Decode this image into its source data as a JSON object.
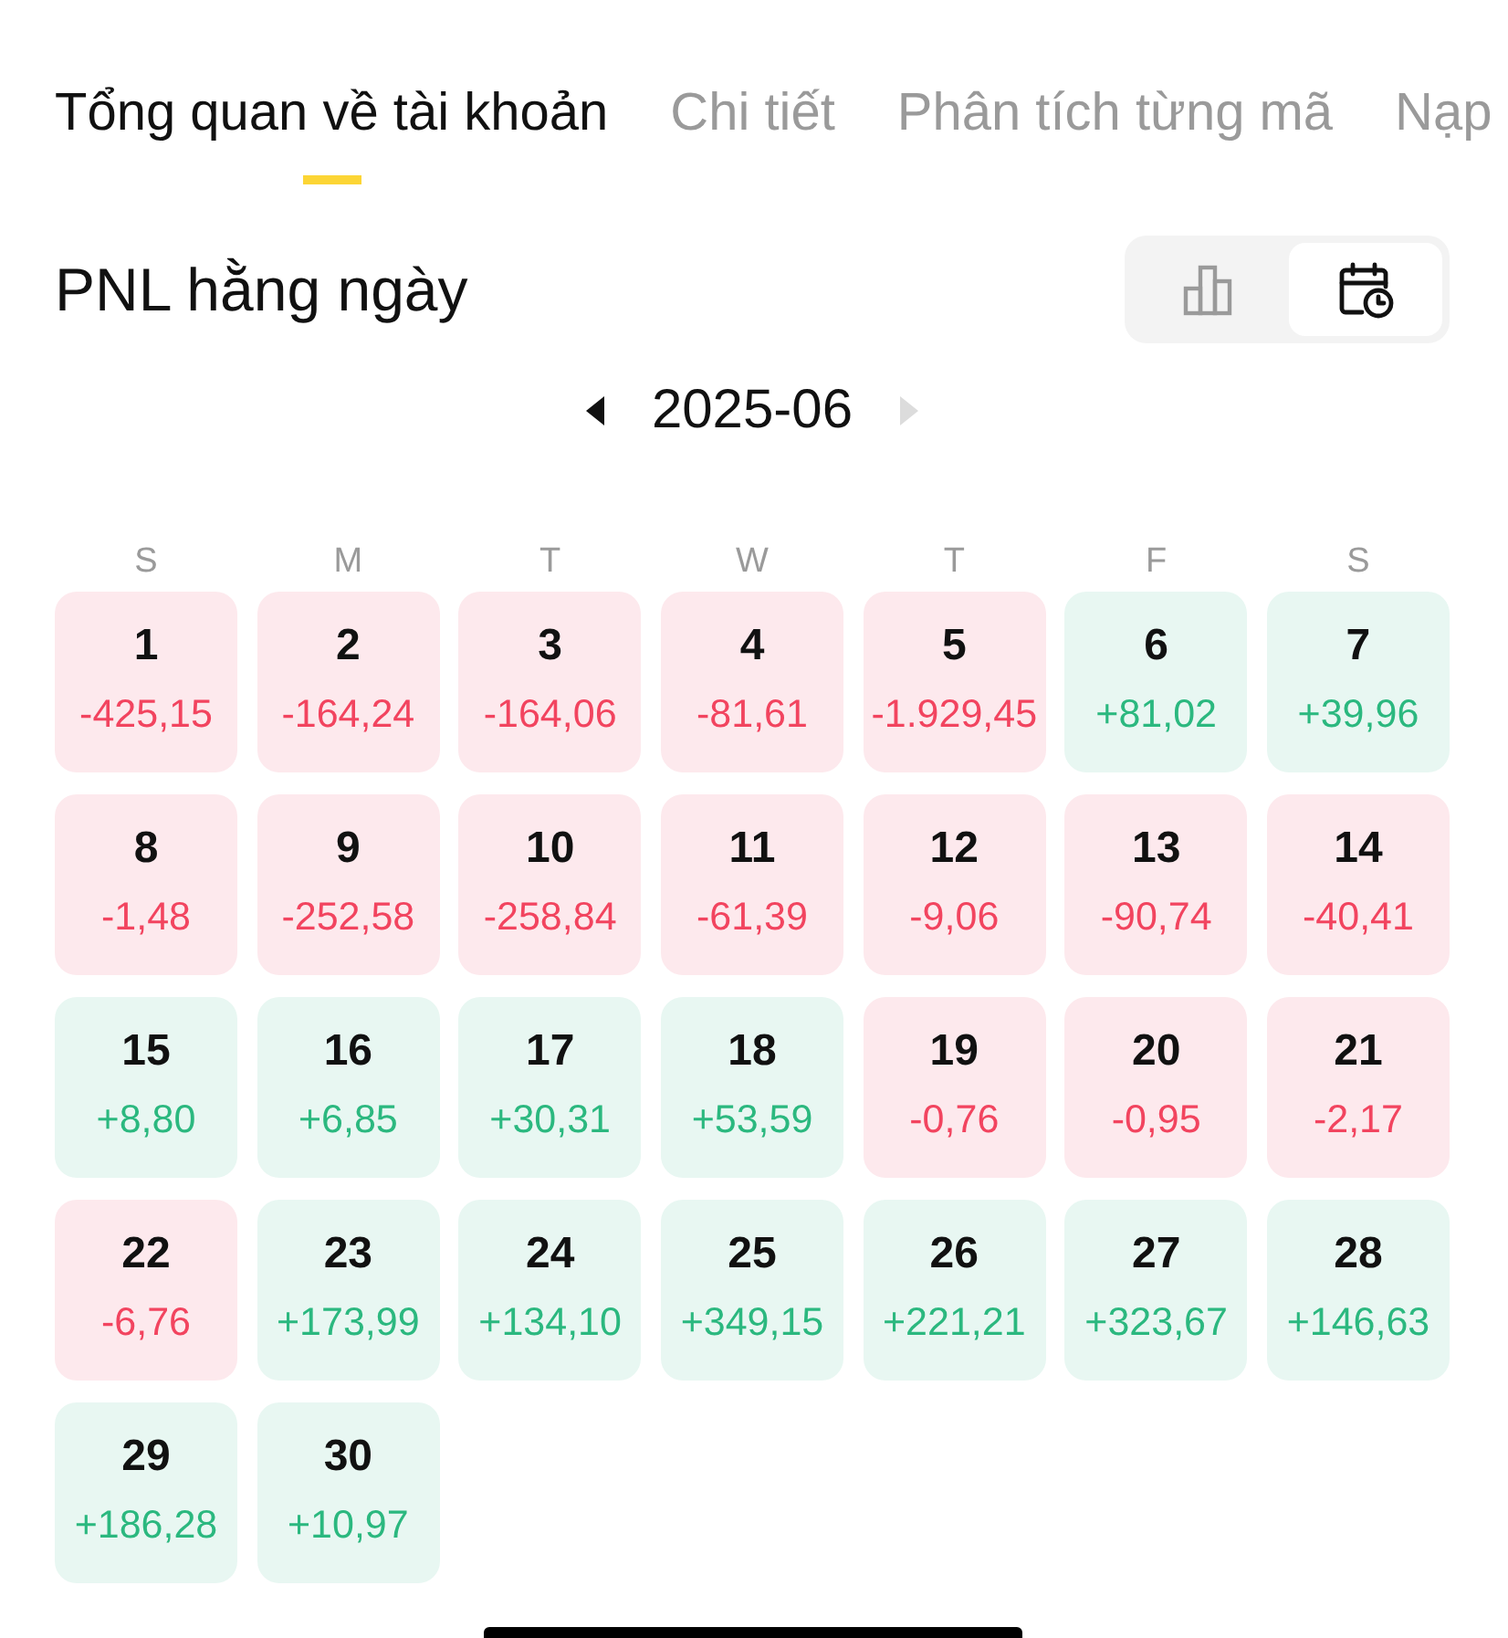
{
  "tabs": [
    {
      "label": "Tổng quan về tài khoản",
      "selected": true
    },
    {
      "label": "Chi tiết",
      "selected": false
    },
    {
      "label": "Phân tích từng mã",
      "selected": false
    },
    {
      "label": "Nạp",
      "selected": false
    }
  ],
  "section": {
    "title": "PNL hằng ngày",
    "view_toggle": [
      {
        "kind": "chart",
        "selected": false
      },
      {
        "kind": "calendar",
        "selected": true
      }
    ]
  },
  "calendar": {
    "month": "2025-06",
    "prev_disabled": false,
    "next_disabled": true,
    "weekdays": [
      "S",
      "M",
      "T",
      "W",
      "T",
      "F",
      "S"
    ],
    "days": [
      {
        "day": "1",
        "pnl": "-425,15",
        "kind": "loss"
      },
      {
        "day": "2",
        "pnl": "-164,24",
        "kind": "loss"
      },
      {
        "day": "3",
        "pnl": "-164,06",
        "kind": "loss"
      },
      {
        "day": "4",
        "pnl": "-81,61",
        "kind": "loss"
      },
      {
        "day": "5",
        "pnl": "-1.929,45",
        "kind": "loss"
      },
      {
        "day": "6",
        "pnl": "+81,02",
        "kind": "gain"
      },
      {
        "day": "7",
        "pnl": "+39,96",
        "kind": "gain"
      },
      {
        "day": "8",
        "pnl": "-1,48",
        "kind": "loss"
      },
      {
        "day": "9",
        "pnl": "-252,58",
        "kind": "loss"
      },
      {
        "day": "10",
        "pnl": "-258,84",
        "kind": "loss"
      },
      {
        "day": "11",
        "pnl": "-61,39",
        "kind": "loss"
      },
      {
        "day": "12",
        "pnl": "-9,06",
        "kind": "loss"
      },
      {
        "day": "13",
        "pnl": "-90,74",
        "kind": "loss"
      },
      {
        "day": "14",
        "pnl": "-40,41",
        "kind": "loss"
      },
      {
        "day": "15",
        "pnl": "+8,80",
        "kind": "gain"
      },
      {
        "day": "16",
        "pnl": "+6,85",
        "kind": "gain"
      },
      {
        "day": "17",
        "pnl": "+30,31",
        "kind": "gain"
      },
      {
        "day": "18",
        "pnl": "+53,59",
        "kind": "gain"
      },
      {
        "day": "19",
        "pnl": "-0,76",
        "kind": "loss"
      },
      {
        "day": "20",
        "pnl": "-0,95",
        "kind": "loss"
      },
      {
        "day": "21",
        "pnl": "-2,17",
        "kind": "loss"
      },
      {
        "day": "22",
        "pnl": "-6,76",
        "kind": "loss"
      },
      {
        "day": "23",
        "pnl": "+173,99",
        "kind": "gain"
      },
      {
        "day": "24",
        "pnl": "+134,10",
        "kind": "gain"
      },
      {
        "day": "25",
        "pnl": "+349,15",
        "kind": "gain"
      },
      {
        "day": "26",
        "pnl": "+221,21",
        "kind": "gain"
      },
      {
        "day": "27",
        "pnl": "+323,67",
        "kind": "gain"
      },
      {
        "day": "28",
        "pnl": "+146,63",
        "kind": "gain"
      },
      {
        "day": "29",
        "pnl": "+186,28",
        "kind": "gain"
      },
      {
        "day": "30",
        "pnl": "+10,97",
        "kind": "gain"
      }
    ]
  }
}
